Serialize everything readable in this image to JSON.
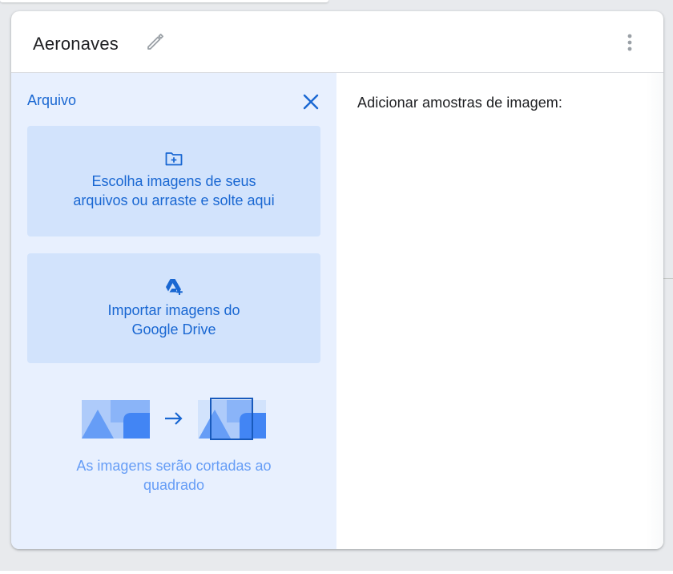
{
  "card": {
    "title": "Aeronaves",
    "edit_icon": "pencil-icon",
    "menu_icon": "more-vertical-icon"
  },
  "upload_panel": {
    "title": "Arquivo",
    "close_icon": "close-icon",
    "options": [
      {
        "label_line1": "Escolha imagens de seus",
        "label_line2": "arquivos ou arraste e solte aqui",
        "icon": "folder-upload-icon"
      },
      {
        "label_line1": "Importar imagens do",
        "label_line2": "Google Drive",
        "icon": "google-drive-icon"
      }
    ],
    "crop_note_line1": "As imagens serão cortadas ao",
    "crop_note_line2": "quadrado",
    "crop_illustration": "image-crop-to-square-illustration"
  },
  "samples": {
    "label": "Adicionar amostras de imagem:"
  },
  "colors": {
    "accent_blue": "#1967d2",
    "panel_bg": "#e8f0fe",
    "option_bg": "#d2e3fc",
    "note_blue": "#669df6"
  }
}
